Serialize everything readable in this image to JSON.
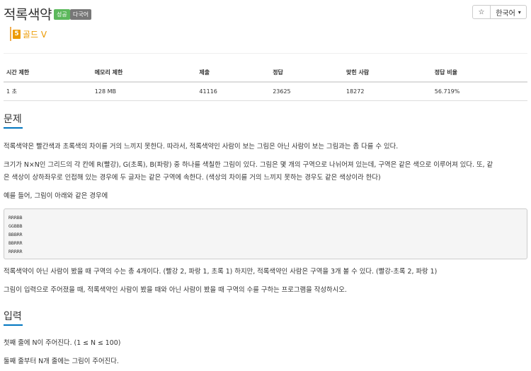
{
  "problem": {
    "title": "적록색약",
    "badges": {
      "success": "성공",
      "language": "다국어"
    },
    "tier": {
      "level": "5",
      "label": "골드 V"
    }
  },
  "toolbar": {
    "star_icon": "star-icon",
    "star_glyph": "☆",
    "language": "한국어",
    "caret": "▾"
  },
  "info_table": {
    "headers": [
      "시간 제한",
      "메모리 제한",
      "제출",
      "정답",
      "맞힌 사람",
      "정답 비율"
    ],
    "values": [
      "1 초",
      "128 MB",
      "41116",
      "23625",
      "18272",
      "56.719%"
    ]
  },
  "sections": {
    "problem": {
      "heading": "문제",
      "p1": "적록색약은 빨간색과 초록색의 차이를 거의 느끼지 못한다. 따라서, 적록색약인 사람이 보는 그림은 아닌 사람이 보는 그림과는 좀 다를 수 있다.",
      "p2_line1": "크기가 N×N인 그리드의 각 칸에 R(빨강), G(초록), B(파랑) 중 하나를 색칠한 그림이 있다. 그림은 몇 개의 구역으로 나뉘어져 있는데, 구역은 같은 색으로 이루어져 있다. 또, 같",
      "p2_line2": "은 색상이 상하좌우로 인접해 있는 경우에 두 글자는 같은 구역에 속한다. (색상의 차이를 거의 느끼지 못하는 경우도 같은 색상이라 한다)",
      "p3": "예를 들어, 그림이 아래와 같은 경우에",
      "grid": [
        "RRRBB",
        "GGBBB",
        "BBBRR",
        "BBRRR",
        "RRRRR"
      ],
      "p4": "적록색약이 아닌 사람이 봤을 때 구역의 수는 총 4개이다. (빨강 2, 파랑 1, 초록 1) 하지만, 적록색약인 사람은 구역을 3개 볼 수 있다. (빨강-초록 2, 파랑 1)",
      "p5": "그림이 입력으로 주어졌을 때, 적록색약인 사람이 봤을 때와 아닌 사람이 봤을 때 구역의 수를 구하는 프로그램을 작성하시오."
    },
    "input": {
      "heading": "입력",
      "p1": "첫째 줄에 N이 주어진다. (1 ≤ N ≤ 100)",
      "p2": "둘째 줄부터 N개 줄에는 그림이 주어진다."
    }
  },
  "colors": {
    "tier": "#ec9a00",
    "success": "#5cb85c",
    "accent": "#0076c0"
  }
}
